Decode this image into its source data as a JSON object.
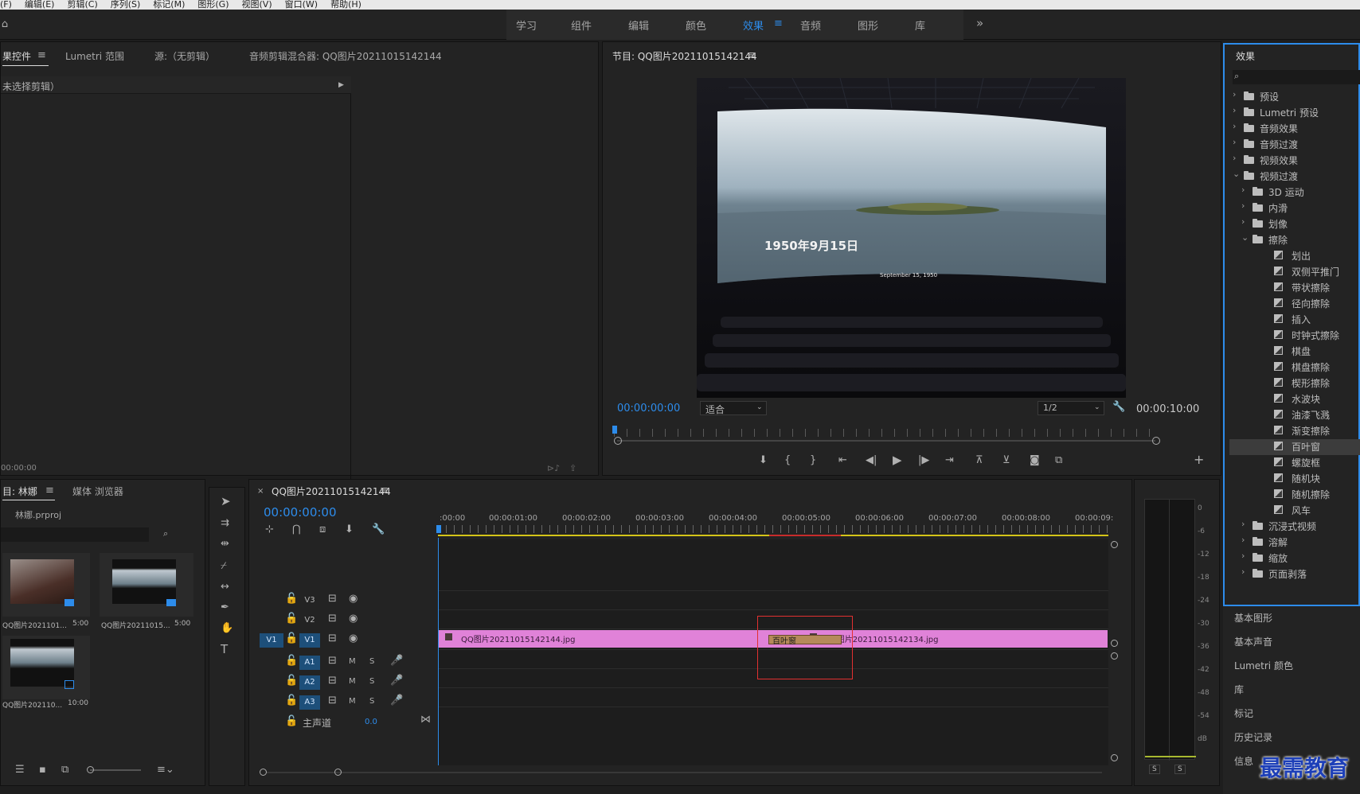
{
  "menu": [
    "(F)",
    "编辑(E)",
    "剪辑(C)",
    "序列(S)",
    "标记(M)",
    "图形(G)",
    "视图(V)",
    "窗口(W)",
    "帮助(H)"
  ],
  "workspaces": [
    "学习",
    "组件",
    "编辑",
    "颜色",
    "效果",
    "音频",
    "图形",
    "库"
  ],
  "active_workspace": "效果",
  "more_label": "»",
  "effect_controls": {
    "tabs": [
      "果控件",
      "Lumetri 范围",
      "源:（无剪辑）",
      "音频剪辑混合器: QQ图片20211015142144"
    ],
    "no_clip": "未选择剪辑）",
    "timecode": "00:00:00"
  },
  "program": {
    "title": "节目: QQ图片20211015142144",
    "date_text": "1950年9月15日",
    "date_sub": "September 15, 1950",
    "timecode": "00:00:00:00",
    "fit": "适合",
    "resolution": "1/2",
    "duration": "00:00:10:00"
  },
  "effects_panel": {
    "title": "效果",
    "search_placeholder": "",
    "items": [
      {
        "level": 0,
        "type": "folder",
        "label": "预设",
        "open": false
      },
      {
        "level": 0,
        "type": "folder",
        "label": "Lumetri 预设",
        "open": false
      },
      {
        "level": 0,
        "type": "folder",
        "label": "音频效果",
        "open": false
      },
      {
        "level": 0,
        "type": "folder",
        "label": "音频过渡",
        "open": false
      },
      {
        "level": 0,
        "type": "folder",
        "label": "视频效果",
        "open": false
      },
      {
        "level": 0,
        "type": "folder",
        "label": "视频过渡",
        "open": true
      },
      {
        "level": 1,
        "type": "folder",
        "label": "3D 运动",
        "open": false
      },
      {
        "level": 1,
        "type": "folder",
        "label": "内滑",
        "open": false
      },
      {
        "level": 1,
        "type": "folder",
        "label": "划像",
        "open": false
      },
      {
        "level": 1,
        "type": "folder",
        "label": "擦除",
        "open": true
      },
      {
        "level": 2,
        "type": "fx",
        "label": "划出"
      },
      {
        "level": 2,
        "type": "fx",
        "label": "双侧平推门"
      },
      {
        "level": 2,
        "type": "fx",
        "label": "带状擦除"
      },
      {
        "level": 2,
        "type": "fx",
        "label": "径向擦除"
      },
      {
        "level": 2,
        "type": "fx",
        "label": "插入"
      },
      {
        "level": 2,
        "type": "fx",
        "label": "时钟式擦除"
      },
      {
        "level": 2,
        "type": "fx",
        "label": "棋盘"
      },
      {
        "level": 2,
        "type": "fx",
        "label": "棋盘擦除"
      },
      {
        "level": 2,
        "type": "fx",
        "label": "楔形擦除"
      },
      {
        "level": 2,
        "type": "fx",
        "label": "水波块"
      },
      {
        "level": 2,
        "type": "fx",
        "label": "油漆飞溅"
      },
      {
        "level": 2,
        "type": "fx",
        "label": "渐变擦除"
      },
      {
        "level": 2,
        "type": "fx",
        "label": "百叶窗",
        "selected": true
      },
      {
        "level": 2,
        "type": "fx",
        "label": "螺旋框"
      },
      {
        "level": 2,
        "type": "fx",
        "label": "随机块"
      },
      {
        "level": 2,
        "type": "fx",
        "label": "随机擦除"
      },
      {
        "level": 2,
        "type": "fx",
        "label": "风车"
      },
      {
        "level": 1,
        "type": "folder",
        "label": "沉浸式视频",
        "open": false
      },
      {
        "level": 1,
        "type": "folder",
        "label": "溶解",
        "open": false
      },
      {
        "level": 1,
        "type": "folder",
        "label": "缩放",
        "open": false
      },
      {
        "level": 1,
        "type": "folder",
        "label": "页面剥落",
        "open": false
      }
    ]
  },
  "side_panels": [
    "基本图形",
    "基本声音",
    "Lumetri 颜色",
    "库",
    "标记",
    "历史记录",
    "信息"
  ],
  "project": {
    "tabs": [
      "目: 林娜",
      "媒体 浏览器"
    ],
    "file": "林娜.prproj",
    "clips": [
      {
        "name": "QQ图片2021101...",
        "dur": "5:00"
      },
      {
        "name": "QQ图片20211015...",
        "dur": "5:00"
      },
      {
        "name": "QQ图片202110...",
        "dur": "10:00"
      }
    ]
  },
  "timeline": {
    "title": "QQ图片20211015142144",
    "timecode": "00:00:00:00",
    "ruler": [
      ":00:00",
      "00:00:01:00",
      "00:00:02:00",
      "00:00:03:00",
      "00:00:04:00",
      "00:00:05:00",
      "00:00:06:00",
      "00:00:07:00",
      "00:00:08:00",
      "00:00:09:"
    ],
    "video_tracks": [
      "V3",
      "V2",
      "V1"
    ],
    "audio_tracks": [
      "A1",
      "A2",
      "A3"
    ],
    "source_patch": "V1",
    "master_label": "主声道",
    "master_value": "0.0",
    "clip1": "QQ图片20211015142144.jpg",
    "clip2": "QQ图片20211015142134.jpg",
    "transition": "百叶窗",
    "mute": "M",
    "solo": "S"
  },
  "meter": {
    "labels": [
      "0",
      "-6",
      "-12",
      "-18",
      "-24",
      "-30",
      "-36",
      "-42",
      "-48",
      "-54",
      "dB"
    ],
    "solo": [
      "S",
      "S"
    ]
  },
  "watermark": "最需教育"
}
